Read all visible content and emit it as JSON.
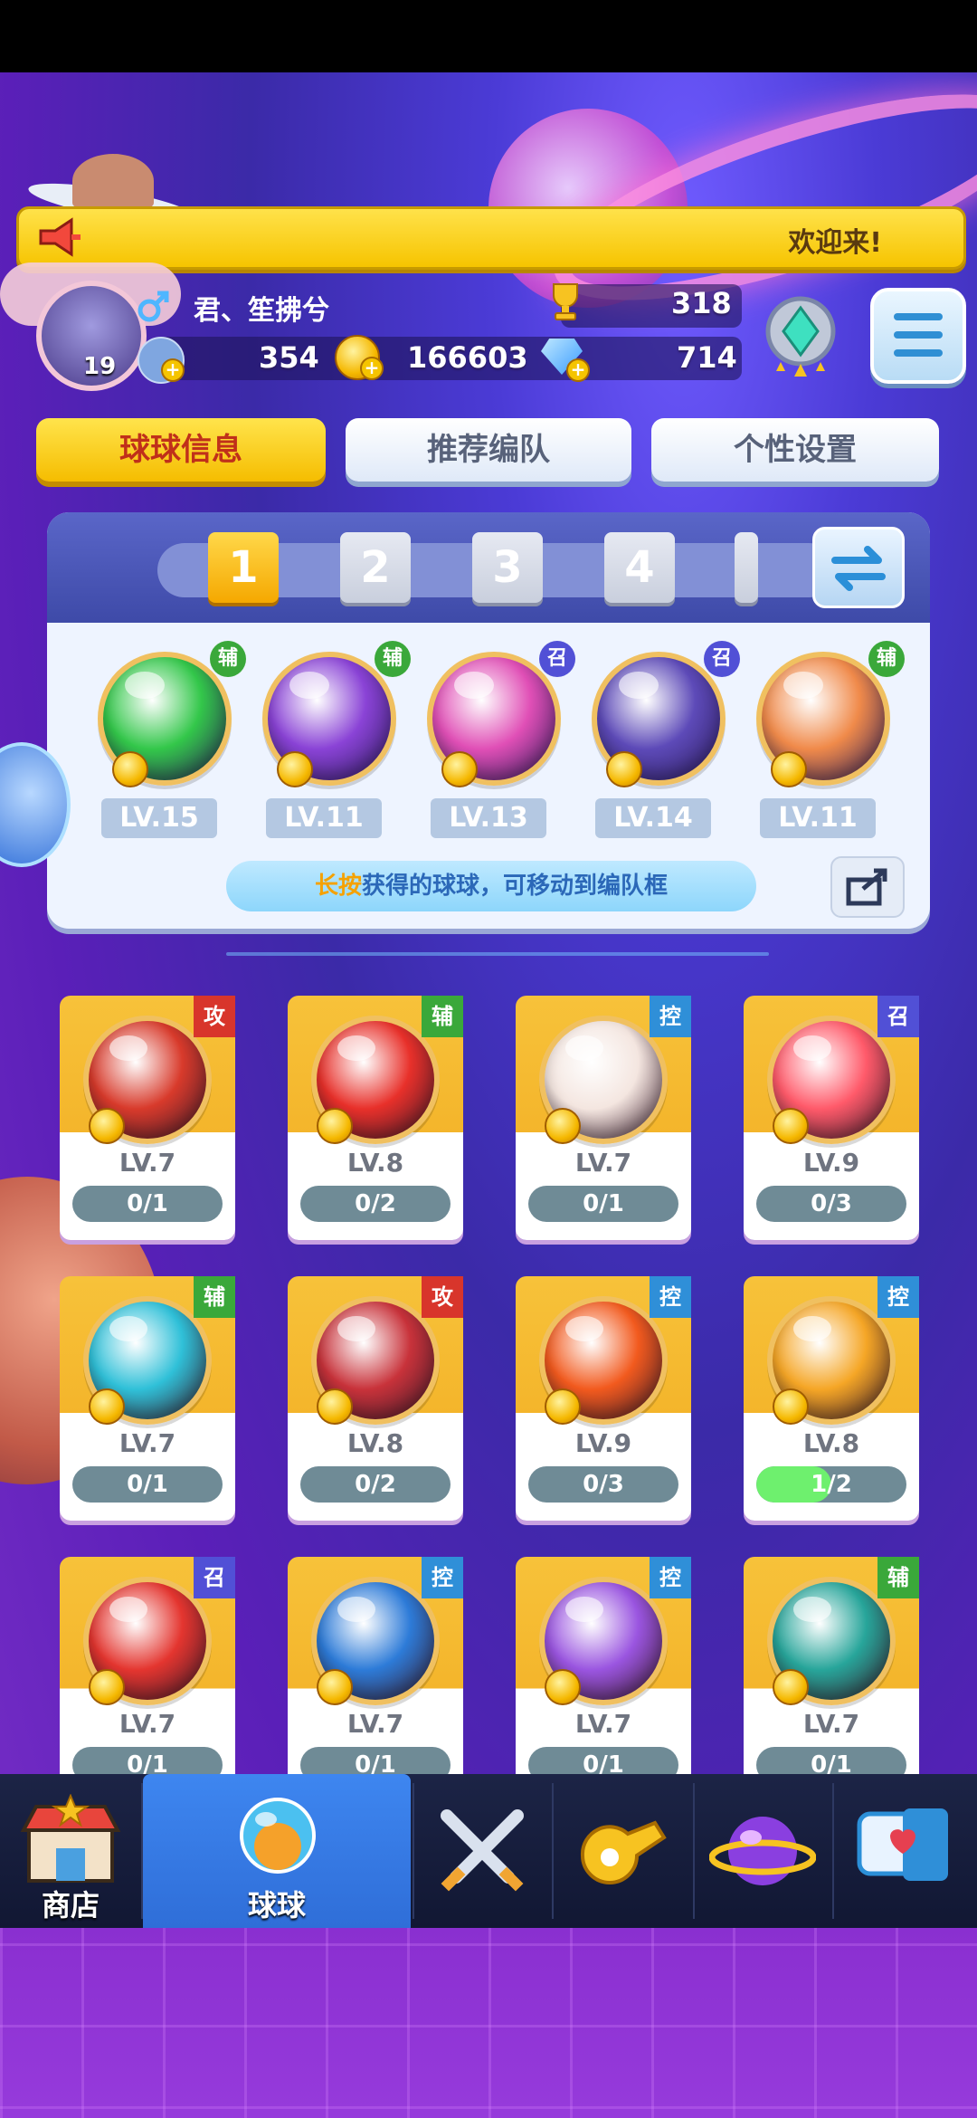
{
  "banner": {
    "text": "欢迎来!"
  },
  "profile": {
    "level": "19",
    "name": "君、笙拂兮",
    "trophies": "318",
    "stat1": "354",
    "coins": "166603",
    "gems": "714"
  },
  "tabs": [
    {
      "label": "球球信息",
      "active": true
    },
    {
      "label": "推荐编队",
      "active": false
    },
    {
      "label": "个性设置",
      "active": false
    }
  ],
  "team": {
    "slots": [
      "1",
      "2",
      "3",
      "4"
    ],
    "active_slot": "1",
    "balls": [
      {
        "level": "LV.15",
        "tag": "辅",
        "tag_color": "#3aa83a",
        "color": "#33c74a"
      },
      {
        "level": "LV.11",
        "tag": "辅",
        "tag_color": "#3aa83a",
        "color": "#8a43d6"
      },
      {
        "level": "LV.13",
        "tag": "召",
        "tag_color": "#5150d6",
        "color": "#e04fb6"
      },
      {
        "level": "LV.14",
        "tag": "召",
        "tag_color": "#5150d6",
        "color": "#5d4ab8"
      },
      {
        "level": "LV.11",
        "tag": "辅",
        "tag_color": "#3aa83a",
        "color": "#f08a4a"
      }
    ],
    "hint_highlight": "长按",
    "hint_text": "获得的球球，可移动到编队框"
  },
  "collection": [
    {
      "level": "LV.7",
      "progress": "0/1",
      "fill": 0,
      "tag": "攻",
      "tag_color": "#d8352b",
      "color": "#d83a2b"
    },
    {
      "level": "LV.8",
      "progress": "0/2",
      "fill": 0,
      "tag": "辅",
      "tag_color": "#3aa83a",
      "color": "#e8302a"
    },
    {
      "level": "LV.7",
      "progress": "0/1",
      "fill": 0,
      "tag": "控",
      "tag_color": "#2f8fd8",
      "color": "#f4e6e0"
    },
    {
      "level": "LV.9",
      "progress": "0/3",
      "fill": 0,
      "tag": "召",
      "tag_color": "#5150d6",
      "color": "#ff5a6a"
    },
    {
      "level": "LV.7",
      "progress": "0/1",
      "fill": 0,
      "tag": "辅",
      "tag_color": "#3aa83a",
      "color": "#2fc0d8"
    },
    {
      "level": "LV.8",
      "progress": "0/2",
      "fill": 0,
      "tag": "攻",
      "tag_color": "#d8352b",
      "color": "#c8323a"
    },
    {
      "level": "LV.9",
      "progress": "0/3",
      "fill": 0,
      "tag": "控",
      "tag_color": "#2f8fd8",
      "color": "#f25a1e"
    },
    {
      "level": "LV.8",
      "progress": "1/2",
      "fill": 0.5,
      "tag": "控",
      "tag_color": "#2f8fd8",
      "color": "#f5a626"
    },
    {
      "level": "LV.7",
      "progress": "0/1",
      "fill": 0,
      "tag": "召",
      "tag_color": "#5150d6",
      "color": "#e4352f"
    },
    {
      "level": "LV.7",
      "progress": "0/1",
      "fill": 0,
      "tag": "控",
      "tag_color": "#2f8fd8",
      "color": "#2d7bd8"
    },
    {
      "level": "LV.7",
      "progress": "0/1",
      "fill": 0,
      "tag": "控",
      "tag_color": "#2f8fd8",
      "color": "#9a55e0"
    },
    {
      "level": "LV.7",
      "progress": "0/1",
      "fill": 0,
      "tag": "辅",
      "tag_color": "#3aa83a",
      "color": "#27a59a"
    }
  ],
  "nav": [
    {
      "label": "商店",
      "icon": "shop-icon",
      "active": false
    },
    {
      "label": "球球",
      "icon": "ball-icon",
      "active": true
    },
    {
      "label": "",
      "icon": "crossed-swords-icon",
      "active": false
    },
    {
      "label": "",
      "icon": "whistle-icon",
      "active": false
    },
    {
      "label": "",
      "icon": "planet-icon",
      "active": false
    },
    {
      "label": "",
      "icon": "chat-heart-icon",
      "active": false
    }
  ]
}
